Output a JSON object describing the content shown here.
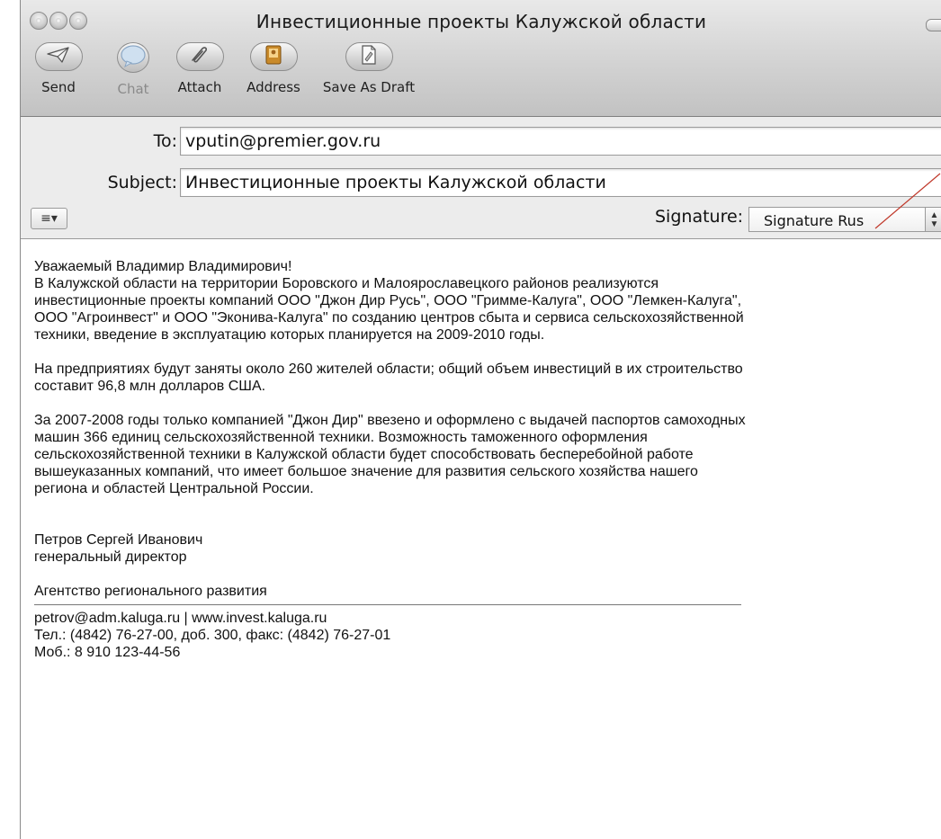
{
  "window": {
    "title": "Инвестиционные проекты Калужской области"
  },
  "toolbar": {
    "buttons": [
      {
        "label": "Send",
        "icon": "paper-plane-icon",
        "enabled": true
      },
      {
        "label": "Chat",
        "icon": "speech-bubble-icon",
        "enabled": false
      },
      {
        "label": "Attach",
        "icon": "paperclip-icon",
        "enabled": true
      },
      {
        "label": "Address",
        "icon": "address-book-icon",
        "enabled": true
      },
      {
        "label": "Save As Draft",
        "icon": "draft-document-icon",
        "enabled": true
      }
    ]
  },
  "header": {
    "to_label": "To:",
    "to_value": "vputin@premier.gov.ru",
    "subject_label": "Subject:",
    "subject_value": "Инвестиционные проекты Калужской области",
    "format_button": "≡▾",
    "signature_label": "Signature:",
    "signature_value": "Signature Rus",
    "annotation_color": "#c0392b"
  },
  "body": {
    "greeting": "Уважаемый Владимир Владимирович!",
    "para1": [
      "В Калужской области на территории Боровского и Малоярославецкого районов реализуются",
      "инвестиционные проекты компаний ООО \"Джон Дир Русь\", ООО \"Гримме-Калуга\", ООО \"Лемкен-Калуга\",",
      "ООО \"Агроинвест\" и ООО \"Эконива-Калуга\" по созданию центров сбыта и сервиса сельскохозяйственной",
      "техники, введение в эксплуатацию которых планируется на 2009-2010 годы."
    ],
    "para2": [
      "На предприятиях будут заняты около 260 жителей области; общий объем инвестиций в их строительство",
      "составит 96,8 млн долларов США."
    ],
    "para3": [
      "За 2007-2008 годы только компанией \"Джон Дир\" ввезено и оформлено с выдачей паспортов самоходных",
      "машин 366 единиц сельскохозяйственной техники. Возможность таможенного оформления",
      "сельскохозяйственной техники в Калужской области будет способствовать бесперебойной работе",
      "вышеуказанных компаний, что имеет большое значение для развития сельского хозяйства нашего",
      "региона и областей Центральной России."
    ],
    "signature": {
      "name": "Петров Сергей Иванович",
      "position": "генеральный директор",
      "organization": "Агентство регионального развития",
      "contacts": "petrov@adm.kaluga.ru | www.invest.kaluga.ru",
      "phone": "Тел.: (4842) 76-27-00, доб. 300, факс: (4842) 76-27-01",
      "mobile": "Моб.: 8 910 123-44-56"
    }
  }
}
